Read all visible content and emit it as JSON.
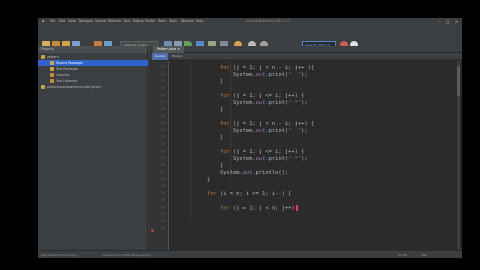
{
  "menu": [
    "File",
    "Edit",
    "View",
    "Navigate",
    "Source",
    "Refactor",
    "Run",
    "Debug",
    "Profile",
    "Team",
    "Tools",
    "Window",
    "Help"
  ],
  "window_title": "Apache NetBeans IDE 12.0",
  "toolbar": {
    "config_combo": "<default config>",
    "search_label": "Search (Ctrl+I)"
  },
  "projects": {
    "panel_title": "Projects",
    "items": [
      {
        "label": "pattern",
        "selected": false,
        "icon_color": "#c9a04a"
      },
      {
        "label": "Source Packages",
        "selected": true,
        "icon_color": "#d6a24a"
      },
      {
        "label": "Test Packages",
        "selected": false,
        "icon_color": "#d6a24a"
      },
      {
        "label": "Libraries",
        "selected": false,
        "icon_color": "#c98a3a"
      },
      {
        "label": "Test Libraries",
        "selected": false,
        "icon_color": "#c98a3a"
      },
      {
        "label": "projectsmanagement-code [main]",
        "selected": false,
        "icon_color": "#c9a04a"
      }
    ]
  },
  "editor": {
    "tab_label": "Pattern.java",
    "subtabs": [
      "Source",
      "History"
    ],
    "line_numbers": [
      "12",
      "13",
      "14",
      "15",
      "16",
      "17",
      "18",
      "19",
      "20",
      "21",
      "22",
      "23",
      "24",
      "25",
      "26",
      "27",
      "28",
      "29",
      "30",
      "31",
      "32",
      "33",
      "34",
      "35"
    ],
    "code_lines": [
      "        for (j = 1; j < n - i; j++ ){",
      "            System.out.print(\"  \");",
      "        }",
      "",
      "        for (j = 1; j <= i; j++) {",
      "            System.out.print(\" *\");",
      "        }",
      "",
      "        for (j = 1; j < n - i; j++) {",
      "            System.out.print(\"  \");",
      "        }",
      "",
      "        for (j = 1; j <= i; j++) {",
      "            System.out.print(\" *\");",
      "        }",
      "        System.out.println();",
      "    }",
      "",
      "    for (i = n; i >= 1; i--) {",
      "        for (j = 1; j < n; j++)"
    ]
  },
  "status": {
    "left": "Quick Search Scanning...",
    "middle": "reached end of file while parsing",
    "position": "33:29",
    "mode": "INS"
  },
  "colors": {
    "accent": "#2f65ca",
    "caret": "#ff2b6b",
    "keyword": "#cc7832"
  }
}
